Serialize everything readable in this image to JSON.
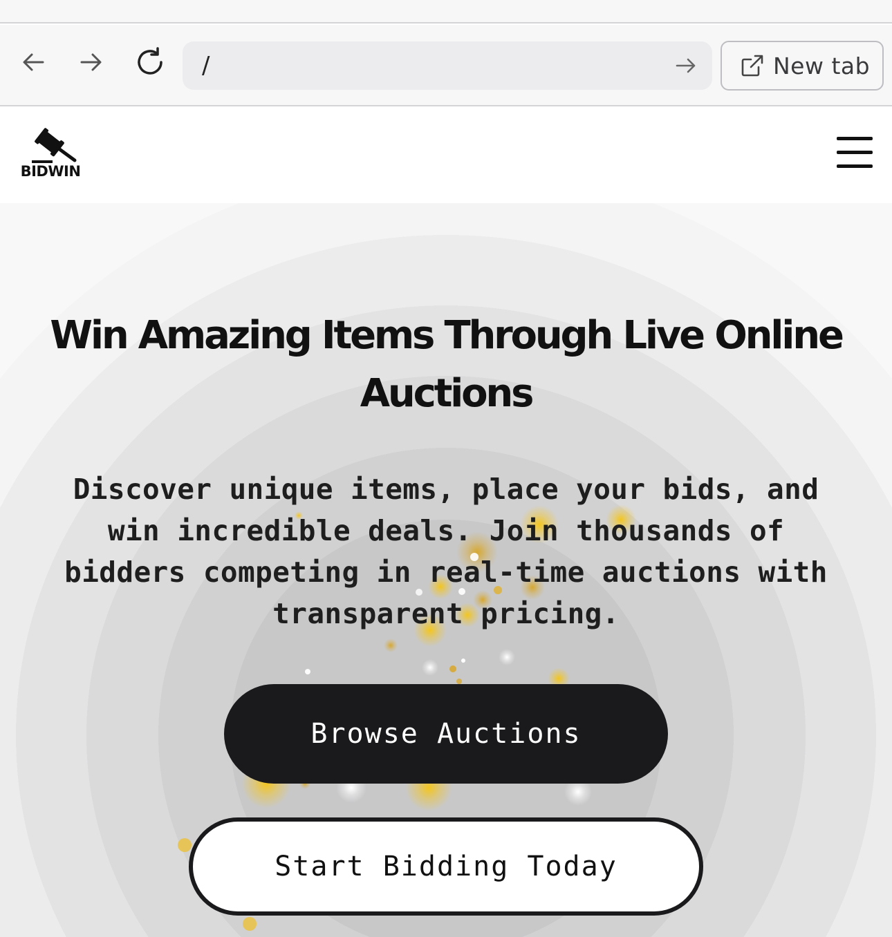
{
  "browser": {
    "url": "/",
    "new_tab_label": "New tab",
    "icons": {
      "back": "arrow-left-icon",
      "forward": "arrow-right-icon",
      "reload": "reload-icon",
      "go": "arrow-right-icon",
      "new_tab": "external-link-icon"
    }
  },
  "header": {
    "logo_text": "BIDWIN",
    "logo_icon": "gavel-icon",
    "menu_icon": "hamburger-menu-icon"
  },
  "hero": {
    "title": "Win Amazing Items Through Live Online Auctions",
    "subtitle": "Discover unique items, place your bids, and win incredible deals. Join thousands of bidders competing in real-time auctions with transparent pricing.",
    "primary_button": "Browse Auctions",
    "secondary_button": "Start Bidding Today"
  },
  "colors": {
    "primary_button_bg": "#1a1a1c",
    "sparkle_gold": "#f5c518",
    "chrome_bg": "#f7f7f8"
  }
}
